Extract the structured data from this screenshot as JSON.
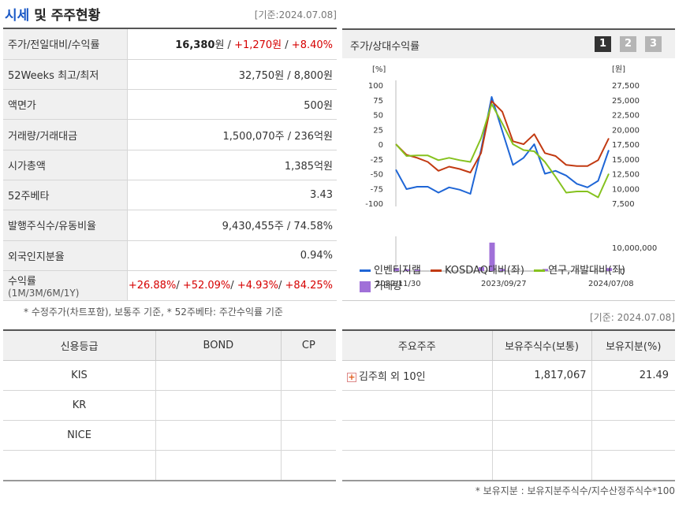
{
  "header": {
    "title_part1": "시세",
    "title_part2": "및 주주현황",
    "date_label": "[기준:2024.07.08]"
  },
  "stats": [
    {
      "label": "주가/전일대비/수익률",
      "price": "16,380",
      "price_unit": "원",
      "sep": " / ",
      "change": "+1,270원",
      "rate": "+8.40%"
    },
    {
      "label": "52Weeks 최고/최저",
      "value": "32,750원 / 8,800원"
    },
    {
      "label": "액면가",
      "value": "500원"
    },
    {
      "label": "거래량/거래대금",
      "value": "1,500,070주 / 236억원"
    },
    {
      "label": "시가총액",
      "value": "1,385억원"
    },
    {
      "label": "52주베타",
      "value": "3.43"
    },
    {
      "label": "발행주식수/유동비율",
      "value": "9,430,455주 / 74.58%"
    },
    {
      "label": "외국인지분율",
      "value": "0.94%"
    },
    {
      "label": "수익률",
      "label_sub": "(1M/3M/6M/1Y)",
      "r1": "+26.88%",
      "r2": "+52.09%",
      "r3": "+4.93%",
      "r4": "+84.25%"
    }
  ],
  "left_note": "* 수정주가(차트포함), 보통주 기준, * 52주베타: 주간수익률 기준",
  "credit": {
    "headers": [
      "신용등급",
      "BOND",
      "CP"
    ],
    "rows": [
      [
        "KIS",
        "",
        ""
      ],
      [
        "KR",
        "",
        ""
      ],
      [
        "NICE",
        "",
        ""
      ],
      [
        "",
        "",
        ""
      ]
    ]
  },
  "chart_panel": {
    "title": "주가/상대수익률",
    "buttons": [
      "1",
      "2",
      "3"
    ],
    "left_unit": "[%]",
    "right_unit": "[원]",
    "legend": [
      "인벤티지랩",
      "KOSDAQ대비(좌)",
      "연구,개발대비(좌)",
      "거래량"
    ],
    "date_label": "[기준: 2024.07.08]"
  },
  "chart_data": {
    "type": "line",
    "x_labels": [
      "2022/11/30",
      "2023/09/27",
      "2024/07/08"
    ],
    "left_ticks": [
      "100",
      "75",
      "50",
      "25",
      "0",
      "-25",
      "-50",
      "-75",
      "-100"
    ],
    "right_ticks": [
      "27,500",
      "25,000",
      "22,500",
      "20,000",
      "17,500",
      "15,000",
      "12,500",
      "10,000",
      "7,500"
    ],
    "volume_ticks": [
      "10,000,000",
      "0"
    ],
    "ylim_left": [
      -100,
      100
    ],
    "ylim_right": [
      7500,
      27500
    ],
    "volume_max": 10000000,
    "x": [
      0,
      0.05,
      0.1,
      0.15,
      0.2,
      0.25,
      0.3,
      0.35,
      0.4,
      0.45,
      0.5,
      0.55,
      0.6,
      0.65,
      0.7,
      0.75,
      0.8,
      0.85,
      0.9,
      0.95,
      1.0
    ],
    "series": [
      {
        "name": "인벤티지랩",
        "color": "#1f66d6",
        "values": [
          -43,
          -76,
          -72,
          -72,
          -82,
          -73,
          -77,
          -84,
          -10,
          80,
          22,
          -35,
          -23,
          0,
          -50,
          -45,
          -53,
          -67,
          -73,
          -62,
          -10
        ]
      },
      {
        "name": "KOSDAQ대비(좌)",
        "color": "#c23a12",
        "values": [
          0,
          -18,
          -23,
          -30,
          -45,
          -38,
          -42,
          -48,
          -15,
          73,
          55,
          5,
          0,
          17,
          -15,
          -20,
          -35,
          -37,
          -37,
          -27,
          10
        ]
      },
      {
        "name": "연구,개발대비(좌)",
        "color": "#86c21f",
        "values": [
          0,
          -20,
          -19,
          -19,
          -27,
          -23,
          -27,
          -30,
          10,
          68,
          35,
          0,
          -10,
          -12,
          -30,
          -55,
          -82,
          -80,
          -80,
          -90,
          -50
        ]
      }
    ],
    "volume": {
      "name": "거래량",
      "color": "#a070d8",
      "values": [
        1000000,
        600000,
        500000,
        0,
        0,
        0,
        0,
        0,
        1300000,
        9500000,
        700000,
        0,
        0,
        0,
        700000,
        0,
        0,
        0,
        0,
        0,
        1000000
      ]
    }
  },
  "holders": {
    "headers": [
      "주요주주",
      "보유주식수(보통)",
      "보유지분(%)"
    ],
    "rows": [
      [
        "김주희 외 10인",
        "1,817,067",
        "21.49"
      ],
      [
        "",
        "",
        ""
      ],
      [
        "",
        "",
        ""
      ],
      [
        "",
        "",
        ""
      ]
    ],
    "note": "* 보유지분 : 보유지분주식수/지수산정주식수*100"
  },
  "colors": {
    "accent": "#1a58c6",
    "up": "#d60000"
  }
}
